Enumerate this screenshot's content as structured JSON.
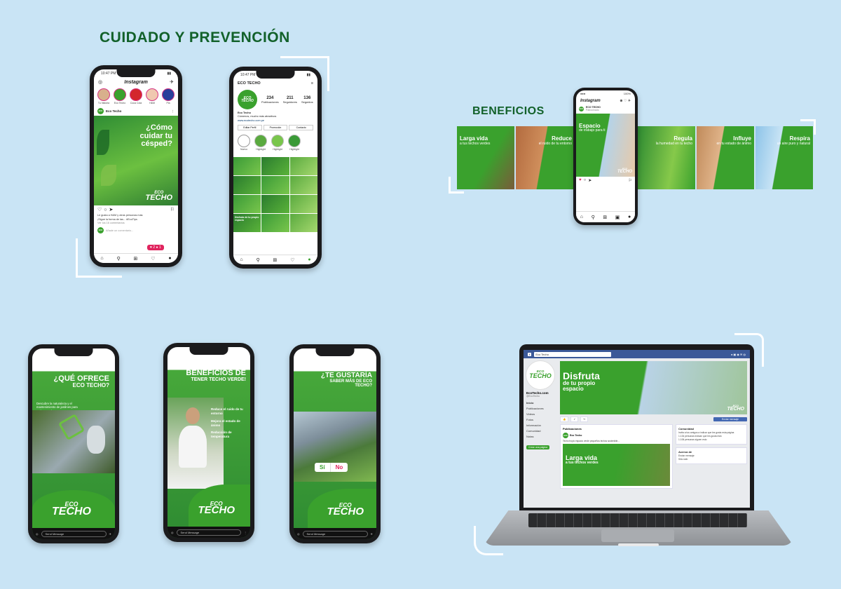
{
  "headings": {
    "section1": "CUIDADO Y PREVENCIÓN",
    "section2": "BENEFICIOS"
  },
  "phone1": {
    "time": "10:47 PM",
    "app": "Instagram",
    "stories": [
      "Tu historia",
      "Eco Techo",
      "Coca Cola",
      "H&M",
      "Pla"
    ],
    "account": "Eco Techo",
    "post_title": "¿Cómo cuidar tu césped?",
    "brand_top": "ECO",
    "brand_bottom": "TECHO",
    "likes_line": "Le gusta a H&M y otras personas más",
    "caption": "¡Sigue la forma de las... #EcoTips",
    "comments": "Ver los 16 comentarios",
    "add_comment": "Añade un comentario...",
    "notif_likes": "2",
    "notif_comments": "1"
  },
  "phone2": {
    "time": "10:47 PM",
    "username": "ECO TECHO",
    "stats": [
      {
        "n": "234",
        "l": "Publicaciones"
      },
      {
        "n": "211",
        "l": "Seguidores"
      },
      {
        "n": "136",
        "l": "Seguidos"
      }
    ],
    "bio_name": "Eco Techo",
    "bio_text": "Cómenos, mucho más atractivos",
    "bio_link": "www.ecotecho.com.pe",
    "buttons": [
      "Editar Perfil",
      "Promoción",
      "Contacto"
    ],
    "highlights": [
      "Nuevo",
      "Highlight",
      "Highlight",
      "Highlight"
    ],
    "grid_labels": [
      "Disfruta de tu propio espacio"
    ]
  },
  "phone3": {
    "app": "Instagram",
    "account": "ECO TECHO",
    "sub": "Patrocinado"
  },
  "carousel": [
    {
      "title": "Larga vida",
      "sub": "a tus techos verdes"
    },
    {
      "title": "Reduce",
      "sub": "el ruido de tu entorno"
    },
    {
      "title": "Espacio",
      "sub": "de trabajo para ti"
    },
    {
      "title": "Regula",
      "sub": "la humedad en tu techo"
    },
    {
      "title": "Influye",
      "sub": "en tu estado de ánimo"
    },
    {
      "title": "Respira",
      "sub": "un aire puro y natural"
    }
  ],
  "stories": [
    {
      "title": "¿QUÉ OFRECE",
      "title2": "ECO TECHO?",
      "body": "Descubre la naturaleza y el mantenimiento de jardines para techos verdes"
    },
    {
      "title": "BENEFICIOS DE",
      "title2": "TENER TECHO VERDE!",
      "items": [
        "Reduce el ruido de tu entorno",
        "Mejora el estado de ánimo",
        "Reducción de temperatura"
      ]
    },
    {
      "title": "¿TE GUSTARÍA",
      "title2": "SABER MÁS DE ECO TECHO?",
      "yes": "Sí",
      "no": "No"
    }
  ],
  "send_message": "Send Message",
  "facebook": {
    "search": "Eco Techo",
    "page_name": "EcoTecho.com",
    "page_handle": "@EcoTecho",
    "cover_title": "Disfruta",
    "cover_sub": "de tu propio espacio",
    "sidebar": [
      "Inicio",
      "Publicaciones",
      "Videos",
      "Fotos",
      "Información",
      "Comunidad",
      "Notas"
    ],
    "sidebar_button": "Crear una página",
    "post_section": "Publicaciones",
    "post_author": "Eco Techo",
    "post_text": "Techo tropic espacio verde pequeños techos sostenible...",
    "post_image_title": "Larga vida",
    "post_image_sub": "a tus techos verdes",
    "community": "Comunidad",
    "community_items": [
      "Invita a tus amigos a indicar que les gusta esta página",
      "1.134 personas indican que les gusta esto",
      "1.106 personas siguen esto"
    ],
    "about": "Acerca de",
    "about_items": [
      "Enviar mensaje",
      "Sitio web"
    ],
    "send_btn": "Enviar mensaje"
  },
  "colors": {
    "bg": "#c9e4f5",
    "heading": "#12612a",
    "brand": "#3aa12d",
    "dark_green": "#1f6b27",
    "like": "#e0245e"
  }
}
